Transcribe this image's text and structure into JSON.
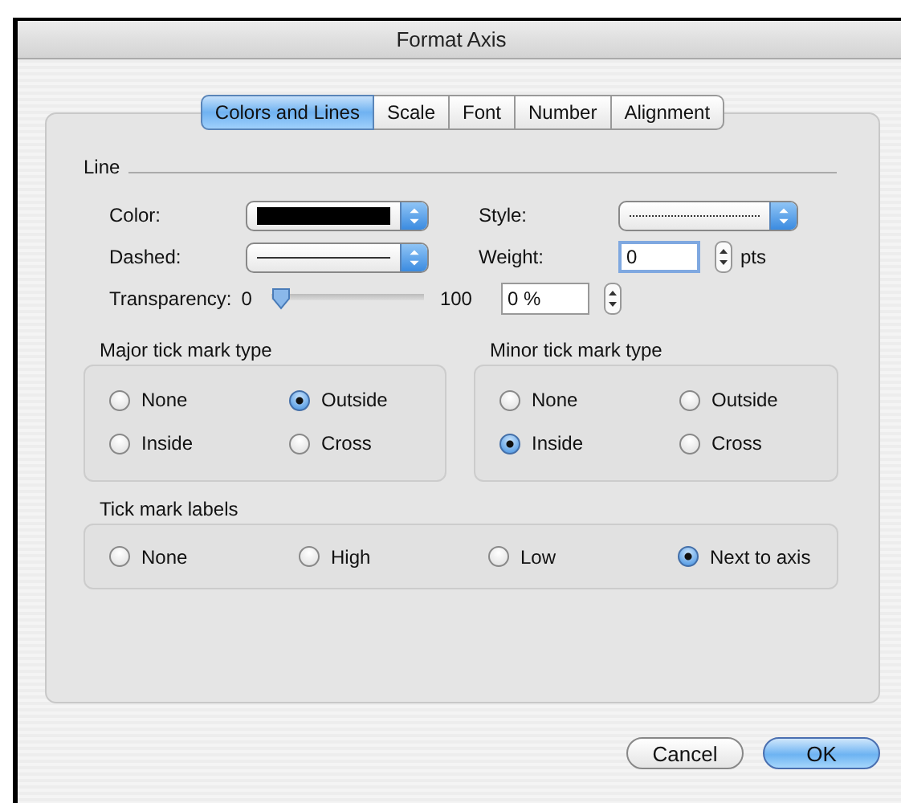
{
  "window": {
    "title": "Format Axis"
  },
  "tabs": [
    {
      "label": "Colors and Lines",
      "selected": true
    },
    {
      "label": "Scale",
      "selected": false
    },
    {
      "label": "Font",
      "selected": false
    },
    {
      "label": "Number",
      "selected": false
    },
    {
      "label": "Alignment",
      "selected": false
    }
  ],
  "line": {
    "title": "Line",
    "color_label": "Color:",
    "color": "#000000",
    "style_label": "Style:",
    "style_line": {
      "kind": "dotted"
    },
    "dashed_label": "Dashed:",
    "dashed_line": {
      "kind": "solid"
    },
    "weight_label": "Weight:",
    "weight_value": "0",
    "weight_focused": true,
    "weight_unit": "pts",
    "transparency_label": "Transparency:",
    "transparency_min": "0",
    "transparency_max": "100",
    "transparency": {
      "level": 0
    },
    "transparency_value": "0 %"
  },
  "major_tick": {
    "title": "Major tick mark type",
    "options": [
      {
        "label": "None",
        "selected": false
      },
      {
        "label": "Outside",
        "selected": true
      },
      {
        "label": "Inside",
        "selected": false
      },
      {
        "label": "Cross",
        "selected": false
      }
    ]
  },
  "minor_tick": {
    "title": "Minor tick mark type",
    "options": [
      {
        "label": "None",
        "selected": false
      },
      {
        "label": "Outside",
        "selected": false
      },
      {
        "label": "Inside",
        "selected": true
      },
      {
        "label": "Cross",
        "selected": false
      }
    ]
  },
  "tick_labels": {
    "title": "Tick mark labels",
    "options": [
      {
        "label": "None",
        "selected": false
      },
      {
        "label": "High",
        "selected": false
      },
      {
        "label": "Low",
        "selected": false
      },
      {
        "label": "Next to axis",
        "selected": true
      }
    ]
  },
  "buttons": [
    {
      "label": "Cancel",
      "default": false
    },
    {
      "label": "OK",
      "default": true
    }
  ]
}
